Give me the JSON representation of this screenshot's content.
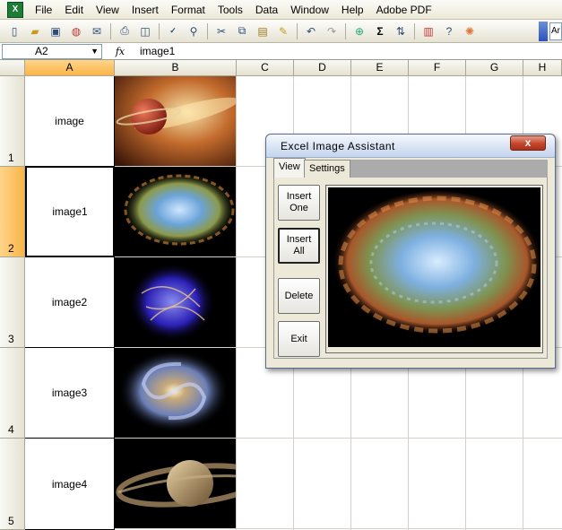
{
  "menu": [
    "File",
    "Edit",
    "View",
    "Insert",
    "Format",
    "Tools",
    "Data",
    "Window",
    "Help",
    "Adobe PDF"
  ],
  "app_icon_label": "X",
  "toolbar": {
    "buttons": [
      "new-icon",
      "open-icon",
      "save-icon",
      "permission-icon",
      "email-icon",
      "print-icon",
      "print-preview-icon",
      "spelling-icon",
      "research-icon",
      "cut-icon",
      "copy-icon",
      "paste-icon",
      "format-painter-icon",
      "undo-icon",
      "redo-icon",
      "hyperlink-icon",
      "autosum-icon",
      "sort-ascending-icon",
      "chart-wizard-icon",
      "help-icon",
      "office-icon"
    ],
    "font_partial": "Ar"
  },
  "formula_bar": {
    "name_box": "A2",
    "fx": "fx",
    "value": "image1"
  },
  "columns": [
    "A",
    "B",
    "C",
    "D",
    "E",
    "F",
    "G",
    "H"
  ],
  "selected_column": "A",
  "rows": [
    {
      "number": "1",
      "label": "image"
    },
    {
      "number": "2",
      "label": "image1"
    },
    {
      "number": "3",
      "label": "image2"
    },
    {
      "number": "4",
      "label": "image3"
    },
    {
      "number": "5",
      "label": "image4"
    }
  ],
  "selected_row": "2",
  "dialog": {
    "title": "Excel  Image  Assistant",
    "close_label": "x",
    "tabs": [
      "View",
      "Settings"
    ],
    "active_tab": "View",
    "buttons": [
      "Insert\nOne",
      "Insert\nAll",
      "Delete",
      "Exit"
    ]
  },
  "colors": {
    "selection_header": "#f9b447",
    "grid_line": "#d4d0c8",
    "dialog_bg": "#ece9d8",
    "close_button": "#c4452a"
  }
}
